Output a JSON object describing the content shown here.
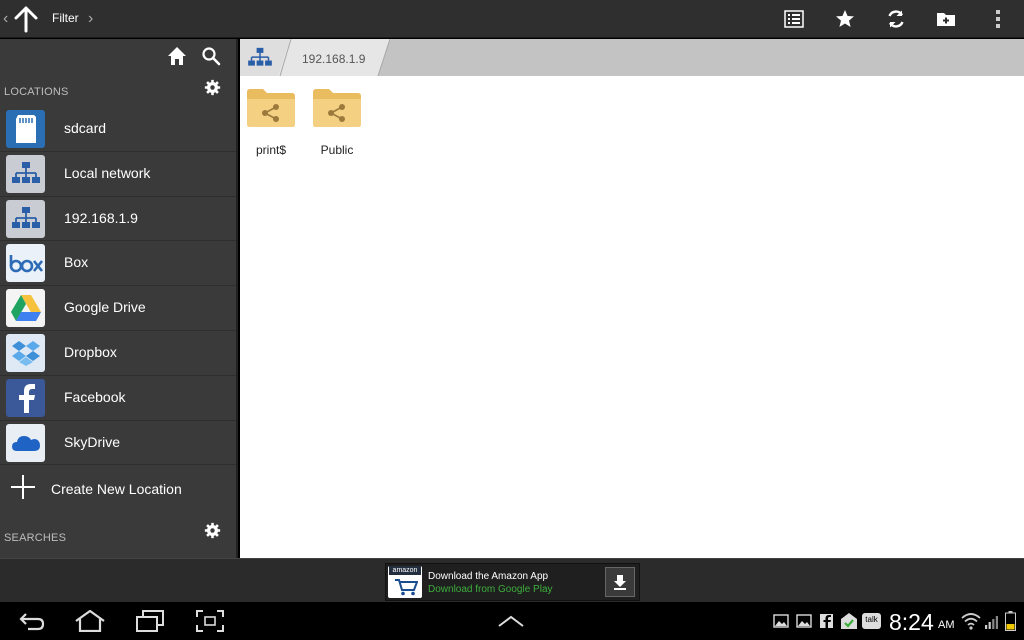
{
  "topbar": {
    "filter_label": "Filter",
    "icons": [
      "back-chevron-icon",
      "up-arrow-icon",
      "forward-chevron-icon",
      "list-view-icon",
      "star-icon",
      "refresh-icon",
      "new-folder-icon",
      "overflow-menu-icon"
    ]
  },
  "sidebar": {
    "locations_title": "LOCATIONS",
    "searches_title": "SEARCHES",
    "items": [
      {
        "label": "sdcard",
        "icon": "sdcard-icon"
      },
      {
        "label": "Local network",
        "icon": "network-icon"
      },
      {
        "label": "192.168.1.9",
        "icon": "network-icon"
      },
      {
        "label": "Box",
        "icon": "box-icon"
      },
      {
        "label": "Google Drive",
        "icon": "google-drive-icon"
      },
      {
        "label": "Dropbox",
        "icon": "dropbox-icon"
      },
      {
        "label": "Facebook",
        "icon": "facebook-icon"
      },
      {
        "label": "SkyDrive",
        "icon": "skydrive-icon"
      }
    ],
    "create_label": "Create New Location"
  },
  "main": {
    "breadcrumb": "192.168.1.9",
    "files": [
      {
        "name": "print$",
        "icon": "shared-folder-icon"
      },
      {
        "name": "Public",
        "icon": "shared-folder-icon"
      }
    ]
  },
  "ad": {
    "logo_text": "amazon",
    "title": "Download the Amazon App",
    "subtitle": "Download from Google Play"
  },
  "statusbar": {
    "time": "8:24",
    "ampm": "AM",
    "talk_label": "talk"
  },
  "colors": {
    "topbar": "#2f2f2f",
    "sidebar": "#3a3a3a",
    "crumbbar": "#c3c3c3",
    "folder": "#f3cf7a",
    "ad_green": "#3cae3c"
  }
}
